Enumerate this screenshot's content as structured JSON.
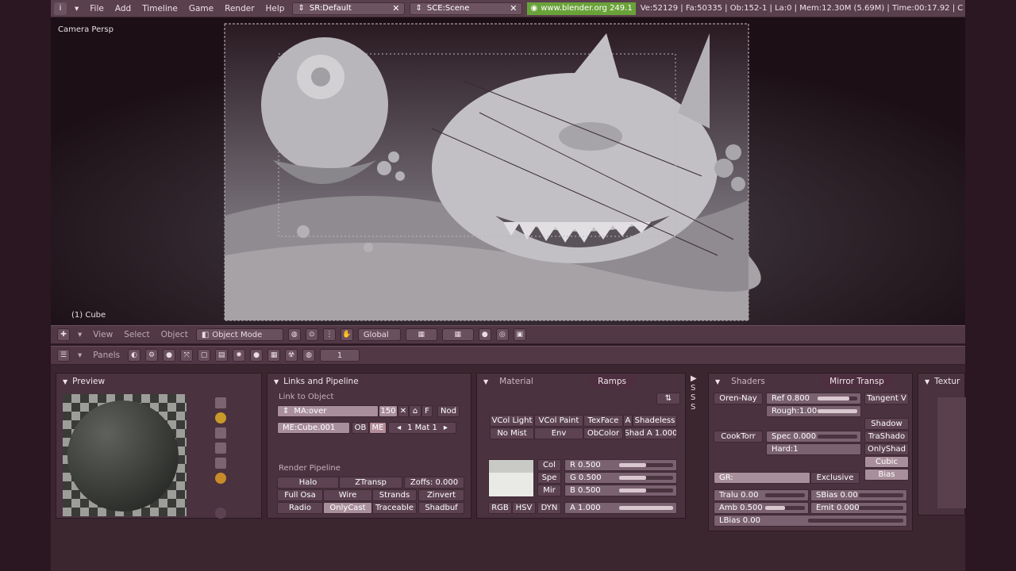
{
  "topbar": {
    "menus": [
      "File",
      "Add",
      "Timeline",
      "Game",
      "Render",
      "Help"
    ],
    "screen": "SR:Default",
    "scene": "SCE:Scene",
    "url": "www.blender.org 249.1",
    "stats": "Ve:52129 | Fa:50335 | Ob:152-1 | La:0 | Mem:12.30M (5.69M) | Time:00:17.92 | C"
  },
  "viewport": {
    "view_label": "Camera Persp",
    "object_label": "(1) Cube"
  },
  "view3d_header": {
    "menus": [
      "View",
      "Select",
      "Object"
    ],
    "mode": "Object Mode",
    "orientation": "Global"
  },
  "buttons_header": {
    "panels_label": "Panels",
    "frame": "1"
  },
  "preview_panel": {
    "title": "Preview"
  },
  "links_panel": {
    "title": "Links and Pipeline",
    "link_to_object": "Link to Object",
    "material_name": "MA:over",
    "users": "150",
    "f_button": "F",
    "nod_button": "Nod",
    "mesh_name": "ME:Cube.001",
    "ob_button": "OB",
    "me_button": "ME",
    "mat_index": "1 Mat 1",
    "render_pipeline": "Render Pipeline",
    "pipeline_buttons": [
      "Halo",
      "ZTransp",
      "Full Osa",
      "Wire",
      "Strands",
      "Zinvert",
      "Radio",
      "OnlyCast",
      "Traceable",
      "Shadbuf"
    ],
    "zoffs": "Zoffs: 0.000"
  },
  "material_panel": {
    "tabs": [
      "Material",
      "Ramps"
    ],
    "row1": [
      "VCol Light",
      "VCol Paint",
      "TexFace",
      "A",
      "Shadeless"
    ],
    "row2": [
      "No Mist",
      "Env",
      "ObColor",
      "Shad A 1.000"
    ],
    "color_buttons": [
      "Col",
      "Spe",
      "Mir"
    ],
    "r": "R 0.500",
    "g": "G 0.500",
    "b": "B 0.500",
    "a": "A 1.000",
    "modes": [
      "RGB",
      "HSV",
      "DYN"
    ],
    "values": {
      "r": 0.5,
      "g": 0.5,
      "b": 0.5,
      "a": 1.0
    }
  },
  "shaders_panel": {
    "tabs": [
      "Shaders",
      "Mirror Transp"
    ],
    "diffuse": "Oren-Nay",
    "ref": "Ref  0.800",
    "rough": "Rough:1.00",
    "tangent": "Tangent V",
    "specular": "CookTorr",
    "spec": "Spec 0.000",
    "hard": "Hard:1",
    "right_buttons": [
      "Shadow",
      "TraShado",
      "OnlyShad",
      "Cubic",
      "Bias"
    ],
    "gr": "GR:",
    "exclusive": "Exclusive",
    "tralu": "Tralu 0.00",
    "sbias": "SBias 0.00",
    "amb": "Amb 0.500",
    "emit": "Emit 0.000",
    "lbias": "LBias 0.00",
    "values": {
      "ref": 0.8,
      "rough": 1.0,
      "spec": 0.0,
      "amb": 0.5
    }
  },
  "texture_panel": {
    "title": "Textur"
  }
}
